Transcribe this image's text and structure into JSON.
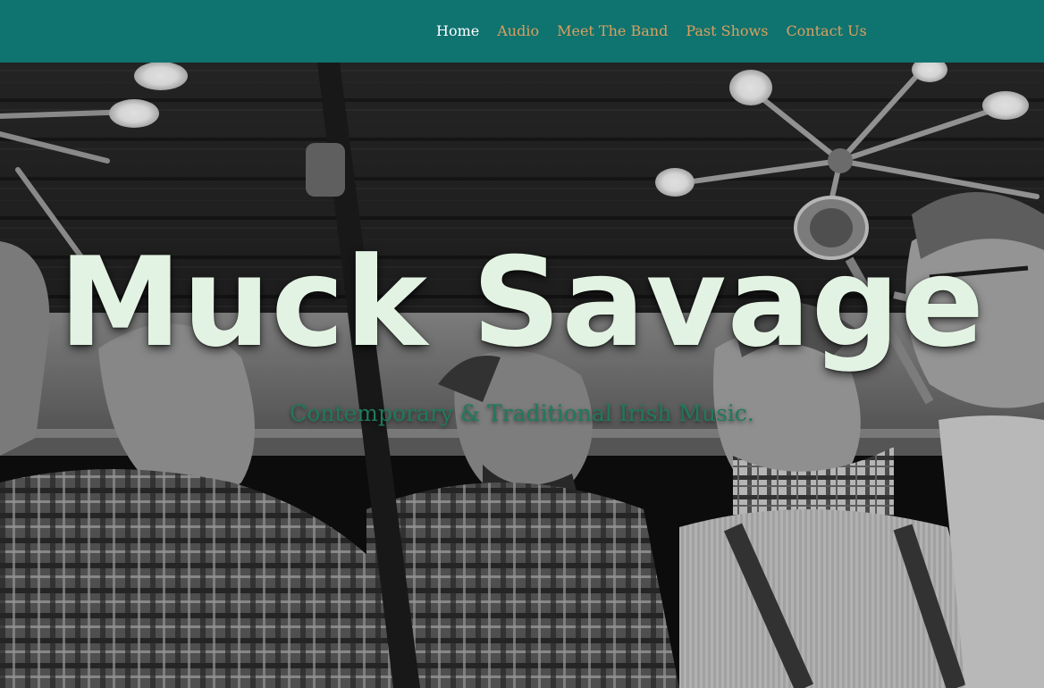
{
  "nav": {
    "items": [
      {
        "label": "Home",
        "active": true
      },
      {
        "label": "Audio",
        "active": false
      },
      {
        "label": "Meet The Band",
        "active": false
      },
      {
        "label": "Past Shows",
        "active": false
      },
      {
        "label": "Contact Us",
        "active": false
      }
    ]
  },
  "hero": {
    "title": "Muck Savage",
    "tagline": "Contemporary & Traditional Irish Music."
  },
  "colors": {
    "header_bg": "#0f7370",
    "nav_link": "#d9a05e",
    "nav_active": "#ffffff",
    "title": "#e3f3e3",
    "tagline": "#1f7a5c"
  }
}
